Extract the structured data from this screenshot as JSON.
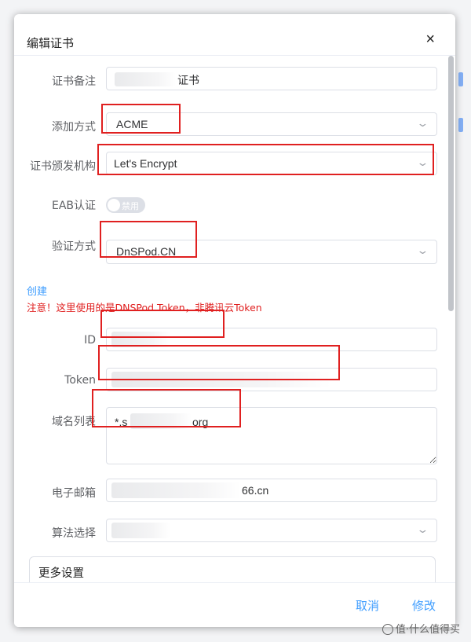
{
  "dialog": {
    "title": "编辑证书",
    "close_icon": "×"
  },
  "form": {
    "remark": {
      "label": "证书备注",
      "value_suffix": "证书"
    },
    "add_method": {
      "label": "添加方式",
      "value": "ACME"
    },
    "ca": {
      "label": "证书颁发机构",
      "value": "Let's Encrypt"
    },
    "eab": {
      "label": "EAB认证",
      "toggle_text": "禁用"
    },
    "verify_method": {
      "label": "验证方式",
      "value": "DnSPod.CN"
    },
    "create_link": "创建",
    "warning": "注意！这里使用的是DNSPod Token，非腾讯云Token",
    "id": {
      "label": "ID",
      "value": ""
    },
    "token": {
      "label": "Token",
      "value": ""
    },
    "domains": {
      "label": "域名列表",
      "value_prefix": "*.s",
      "value_suffix": "org"
    },
    "email": {
      "label": "电子邮箱",
      "value_suffix": "66.cn"
    },
    "algorithm": {
      "label": "算法选择",
      "value": ""
    },
    "more_settings": "更多设置"
  },
  "footer": {
    "cancel": "取消",
    "submit": "修改"
  },
  "watermark": "值·什么值得买",
  "icons": {
    "chevron": "chevron-down-icon",
    "close": "close-icon"
  },
  "colors": {
    "accent": "#409eff",
    "highlight": "#e02020"
  }
}
